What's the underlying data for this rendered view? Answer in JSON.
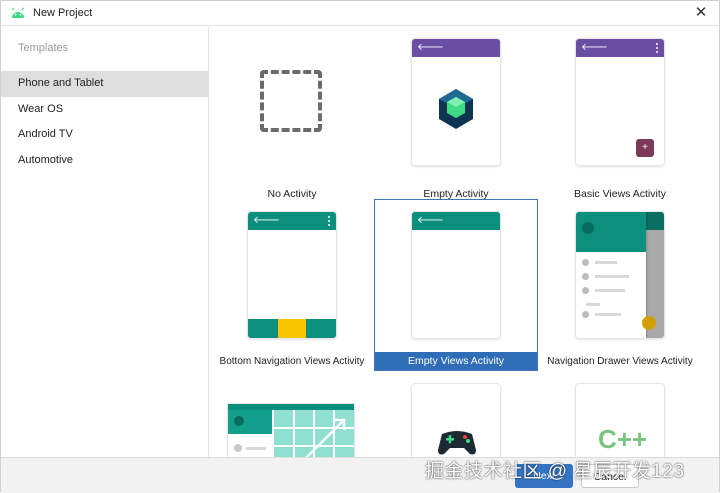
{
  "window": {
    "title": "New Project",
    "close_glyph": "✕"
  },
  "sidebar": {
    "header": "Templates",
    "items": [
      {
        "label": "Phone and Tablet",
        "selected": true
      },
      {
        "label": "Wear OS",
        "selected": false
      },
      {
        "label": "Android TV",
        "selected": false
      },
      {
        "label": "Automotive",
        "selected": false
      }
    ]
  },
  "templates": [
    {
      "label": "No Activity",
      "selected": false
    },
    {
      "label": "Empty Activity",
      "selected": false
    },
    {
      "label": "Basic Views Activity",
      "selected": false
    },
    {
      "label": "Bottom Navigation Views Activity",
      "selected": false
    },
    {
      "label": "Empty Views Activity",
      "selected": true
    },
    {
      "label": "Navigation Drawer Views Activity",
      "selected": false
    }
  ],
  "icons": {
    "back_arrow": "🡐",
    "fab_plus": "+",
    "cpp": "C++"
  },
  "footer": {
    "primary_label": "Next",
    "secondary_label": "Cancel"
  },
  "watermark": "掘金技术社区 @ 星辰开发123",
  "colors": {
    "accent": "#3574c4",
    "selection": "#2f6eb7",
    "purple_bar": "#6a4ea3",
    "teal_bar": "#0c8f7d",
    "android_green": "#3ddc84"
  }
}
